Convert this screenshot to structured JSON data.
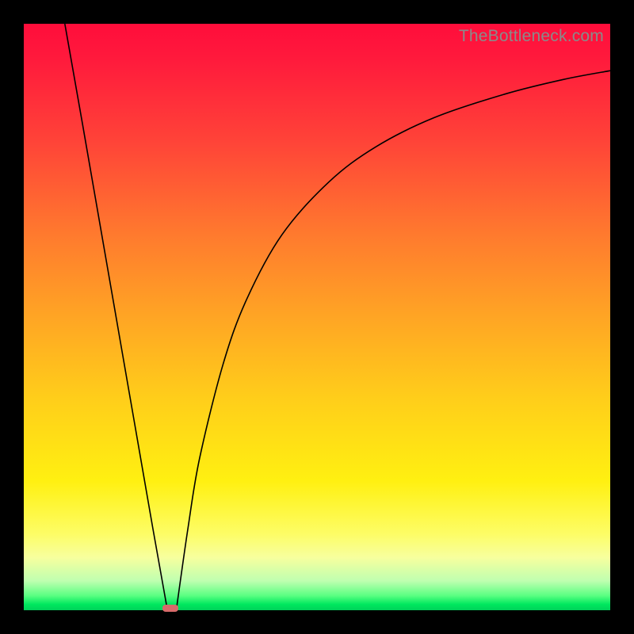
{
  "watermark": "TheBottleneck.com",
  "chart_data": {
    "type": "line",
    "title": "",
    "xlabel": "",
    "ylabel": "",
    "xlim": [
      0,
      100
    ],
    "ylim": [
      0,
      100
    ],
    "grid": false,
    "legend": false,
    "gradient_meaning": "vertical color = bottleneck severity (red high, green low)",
    "series": [
      {
        "name": "left-branch",
        "x": [
          7,
          10,
          14,
          18,
          22,
          24.5
        ],
        "y": [
          100,
          83,
          60,
          37,
          14,
          0
        ]
      },
      {
        "name": "right-branch",
        "x": [
          26,
          28,
          30,
          34,
          38,
          44,
          52,
          60,
          70,
          82,
          92,
          100
        ],
        "y": [
          0,
          14,
          26,
          42,
          53,
          64,
          73,
          79,
          84,
          88,
          90.5,
          92
        ]
      }
    ],
    "marker": {
      "name": "optimal-point",
      "x": 25,
      "y": 0,
      "shape": "rounded-bar",
      "color": "#d86a6a"
    }
  }
}
